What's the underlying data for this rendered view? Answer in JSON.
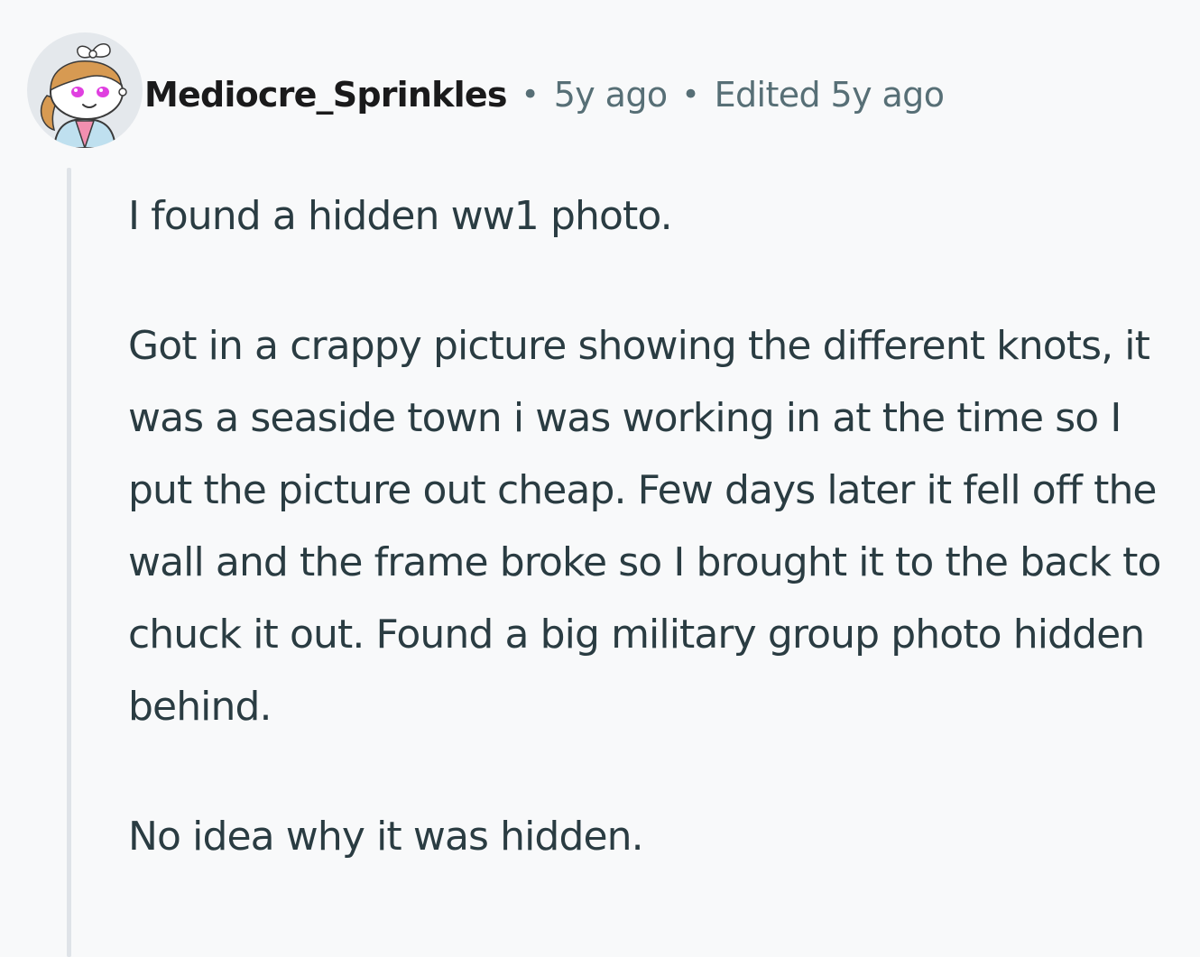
{
  "comment": {
    "author": "Mediocre_Sprinkles",
    "separator": "•",
    "age": "5y ago",
    "edited": "Edited 5y ago",
    "avatar_icon": "reddit-snoo-avatar-icon",
    "paragraphs": [
      "I found a hidden ww1 photo.",
      "Got in a crappy picture showing the different knots, it was a seaside town i was working in at the time so I put the picture out cheap. Few days later it fell off the wall and the frame broke so I brought it to the back to chuck it out. Found a big military group photo hidden behind.",
      "No idea why it was hidden."
    ]
  },
  "colors": {
    "background": "#f8f9fa",
    "text": "#2a3c42",
    "meta": "#576f76",
    "thread_line": "#dfe3e8"
  }
}
